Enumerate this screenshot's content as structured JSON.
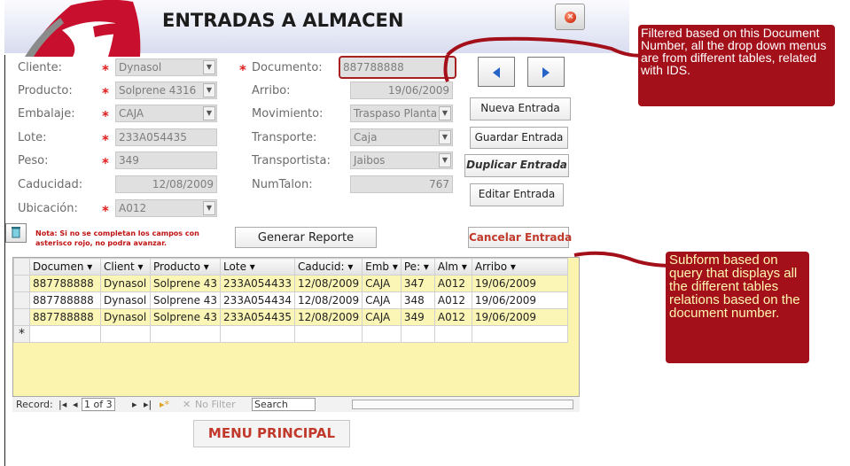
{
  "window": {
    "title": "ENTRADAS A ALMACEN",
    "close_icon": "close-icon",
    "colors": {
      "title_text": "#1c1c1c",
      "required_star": "#e01c1c",
      "accent_red": "#c0392b",
      "annotation": "#a3101a"
    }
  },
  "form": {
    "left_fields": [
      {
        "label": "Cliente:",
        "required": "*",
        "value": "Dynasol",
        "dropdown": true
      },
      {
        "label": "Producto:",
        "required": "*",
        "value": "Solprene 4316",
        "dropdown": true
      },
      {
        "label": "Embalaje:",
        "required": "*",
        "value": "CAJA",
        "dropdown": true
      },
      {
        "label": "Lote:",
        "required": "*",
        "value": "233A054435",
        "dropdown": false
      },
      {
        "label": "Peso:",
        "required": "*",
        "value": "349",
        "dropdown": false
      },
      {
        "label": "Caducidad:",
        "required": "",
        "value": "12/08/2009",
        "dropdown": false
      },
      {
        "label": "Ubicación:",
        "required": "*",
        "value": "A012",
        "dropdown": true
      }
    ],
    "right_fields": [
      {
        "label": "Documento:",
        "required": "*",
        "value": "887788888"
      },
      {
        "label": "Arribo:",
        "required": "",
        "value": "19/06/2009"
      },
      {
        "label": "Movimiento:",
        "required": "",
        "value": "Traspaso Planta"
      },
      {
        "label": "Transporte:",
        "required": "",
        "value": "Caja"
      },
      {
        "label": "Transportista:",
        "required": "",
        "value": "Jaibos"
      },
      {
        "label": "NumTalon:",
        "required": "",
        "value": "767"
      }
    ]
  },
  "buttons": {
    "prev_icon": "arrow-left-icon",
    "next_icon": "arrow-right-icon",
    "nueva": "Nueva Entrada",
    "guardar": "Guardar Entrada",
    "duplicar": "Duplicar Entrada",
    "editar": "Editar Entrada",
    "generar": "Generar Reporte",
    "cancelar": "Cancelar Entrada",
    "menu": "MENU PRINCIPAL",
    "recycle_icon": "recycle-bin-icon"
  },
  "note": "Nota: Si no se completan los campos con asterisco rojo, no podra avanzar.",
  "datasheet": {
    "columns": [
      "Documen ▾",
      "Client ▾",
      "Producto ▾",
      "Lote ▾",
      "Caducid: ▾",
      "Emb ▾",
      "Pe: ▾",
      "Alm ▾",
      "Arribo ▾"
    ],
    "rows": [
      [
        "887788888",
        "Dynasol",
        "Solprene 43",
        "233A054433",
        "12/08/2009",
        "CAJA",
        "347",
        "A012",
        "19/06/2009"
      ],
      [
        "887788888",
        "Dynasol",
        "Solprene 43",
        "233A054434",
        "12/08/2009",
        "CAJA",
        "348",
        "A012",
        "19/06/2009"
      ],
      [
        "887788888",
        "Dynasol",
        "Solprene 43",
        "233A054435",
        "12/08/2009",
        "CAJA",
        "349",
        "A012",
        "19/06/2009"
      ]
    ],
    "new_row_marker": "*",
    "navbar": {
      "record_label": "Record:",
      "position": "1 of 3",
      "filter": "No Filter",
      "search": "Search"
    }
  },
  "annotations": {
    "top": "Filtered based on this Document Number, all the drop down menus are from different tables, related with IDS.",
    "bottom": "Subform based on query that displays all the different tables relations based on the document number."
  }
}
